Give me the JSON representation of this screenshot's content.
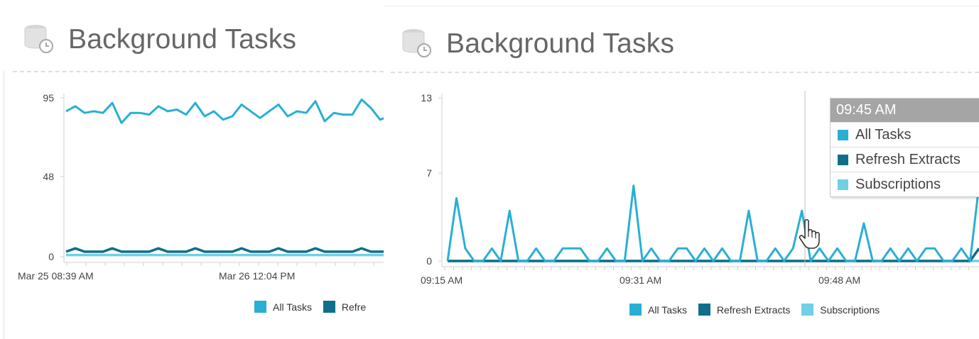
{
  "colors": {
    "all_tasks": "#29afd4",
    "refresh_extracts": "#0f6e8a",
    "subscriptions": "#6fd0e6"
  },
  "left": {
    "title": "Background Tasks",
    "icon": "database-clock-icon",
    "legend": [
      "All Tasks",
      "Refre"
    ]
  },
  "right": {
    "title": "Background Tasks",
    "icon": "database-clock-icon",
    "legend": [
      "All Tasks",
      "Refresh Extracts",
      "Subscriptions"
    ],
    "tooltip": {
      "time": "09:45 AM",
      "items": [
        "All Tasks",
        "Refresh Extracts",
        "Subscriptions"
      ]
    }
  },
  "chart_data": [
    {
      "type": "line",
      "title": "",
      "xlabel": "",
      "ylabel": "",
      "ylim": [
        0,
        95
      ],
      "y_ticks": [
        "95",
        "48",
        "0"
      ],
      "x_tick_labels": [
        "Mar 25 08:39 AM",
        "Mar 26 12:04 PM"
      ],
      "grid": false,
      "legend_position": "bottom",
      "series": [
        {
          "name": "All Tasks",
          "values": [
            87,
            90,
            86,
            87,
            86,
            92,
            80,
            86,
            86,
            85,
            90,
            87,
            88,
            85,
            92,
            84,
            87,
            82,
            84,
            91,
            87,
            83,
            87,
            91,
            84,
            87,
            86,
            93,
            81,
            86,
            85,
            85,
            94,
            89,
            82,
            84
          ]
        },
        {
          "name": "Refresh Extracts",
          "values": [
            3,
            5,
            3,
            3,
            3,
            5,
            3,
            3,
            3,
            3,
            5,
            3,
            3,
            3,
            5,
            3,
            3,
            3,
            3,
            5,
            3,
            3,
            3,
            5,
            3,
            3,
            3,
            5,
            3,
            3,
            3,
            3,
            5,
            3,
            3,
            3
          ]
        },
        {
          "name": "Subscriptions",
          "values": [
            1,
            1,
            1,
            1,
            1,
            1,
            1,
            1,
            1,
            1,
            1,
            1,
            1,
            1,
            1,
            1,
            1,
            1,
            1,
            1,
            1,
            1,
            1,
            1,
            1,
            1,
            1,
            1,
            1,
            1,
            1,
            1,
            1,
            1,
            1,
            1
          ]
        }
      ]
    },
    {
      "type": "line",
      "title": "",
      "xlabel": "",
      "ylabel": "",
      "ylim": [
        0,
        13
      ],
      "y_ticks": [
        "13",
        "7",
        "0"
      ],
      "x_tick_labels": [
        "09:15 AM",
        "09:31 AM",
        "09:48 AM"
      ],
      "grid": false,
      "legend_position": "bottom",
      "series": [
        {
          "name": "All Tasks",
          "values": [
            0,
            5,
            1,
            0,
            0,
            1,
            0,
            4,
            0,
            0,
            1,
            0,
            0,
            1,
            1,
            1,
            0,
            0,
            1,
            0,
            0,
            6,
            0,
            1,
            0,
            0,
            1,
            1,
            0,
            1,
            0,
            1,
            0,
            0,
            4,
            0,
            0,
            1,
            0,
            1,
            4,
            0,
            1,
            0,
            1,
            0,
            0,
            3,
            0,
            0,
            1,
            0,
            1,
            0,
            1,
            1,
            0,
            0,
            1,
            0,
            6
          ]
        },
        {
          "name": "Refresh Extracts",
          "values": [
            0,
            0,
            0,
            0,
            0,
            0,
            0,
            0,
            0,
            0,
            0,
            0,
            0,
            0,
            0,
            0,
            0,
            0,
            0,
            0,
            0,
            0,
            0,
            0,
            0,
            0,
            0,
            0,
            0,
            0,
            0,
            0,
            0,
            0,
            0,
            0,
            0,
            0,
            0,
            0,
            0,
            0,
            0,
            0,
            0,
            0,
            0,
            0,
            0,
            0,
            0,
            0,
            0,
            0,
            0,
            0,
            0,
            0,
            0,
            0,
            1
          ]
        },
        {
          "name": "Subscriptions",
          "values": [
            0,
            0,
            0,
            0,
            0,
            0,
            0,
            0,
            0,
            0,
            0,
            0,
            0,
            0,
            0,
            0,
            0,
            0,
            0,
            0,
            0,
            0,
            0,
            0,
            0,
            0,
            0,
            0,
            0,
            0,
            0,
            0,
            0,
            0,
            0,
            0,
            0,
            0,
            0,
            0,
            0,
            0,
            0,
            0,
            0,
            0,
            0,
            0,
            0,
            0,
            0,
            0,
            0,
            0,
            0,
            0,
            0,
            0,
            0,
            0,
            0
          ]
        }
      ]
    }
  ]
}
